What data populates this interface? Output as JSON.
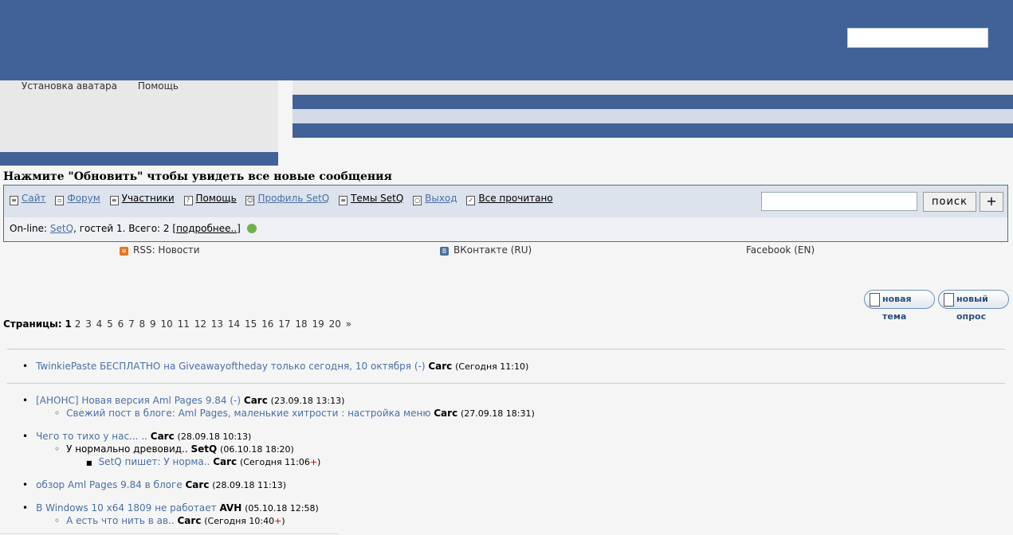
{
  "header": {
    "search_value": ""
  },
  "left_links": {
    "avatar": "Установка аватара",
    "help": "Помощь"
  },
  "refresh_notice": "Нажмите \"Обновить\" чтобы увидеть все новые сообщения",
  "nav": {
    "items": [
      {
        "label": "Сайт",
        "icon": "site-icon",
        "blue": true
      },
      {
        "label": "Форум",
        "icon": "forum-icon",
        "blue": true
      },
      {
        "label": "Участники",
        "icon": "members-icon",
        "blue": false
      },
      {
        "label": "Помощь",
        "icon": "help-icon",
        "blue": false
      },
      {
        "label": "Профиль SetQ",
        "icon": "profile-icon",
        "blue": true
      },
      {
        "label": "Темы SetQ",
        "icon": "topics-icon",
        "blue": false
      },
      {
        "label": "Выход",
        "icon": "logout-icon",
        "blue": true
      },
      {
        "label": "Все прочитано",
        "icon": "checkbox-icon",
        "blue": false
      }
    ],
    "search_button": "поиск",
    "plus_button": "+"
  },
  "online": {
    "prefix": "On-line:",
    "user": "SetQ",
    "rest": ", гостей 1. Всего: 2 [",
    "more": "подробнее..",
    "close": "]"
  },
  "social": {
    "rss": "RSS: Новости",
    "vk": "ВКонтакте (RU)",
    "fb": "Facebook (EN)"
  },
  "buttons": {
    "new_topic": "новая тема",
    "new_poll": "новый опрос"
  },
  "pagination": {
    "label": "Страницы:",
    "current": "1",
    "pages": [
      "2",
      "3",
      "4",
      "5",
      "6",
      "7",
      "8",
      "9",
      "10",
      "11",
      "12",
      "13",
      "14",
      "15",
      "16",
      "17",
      "18",
      "19",
      "20",
      "»"
    ]
  },
  "topics": {
    "t1": {
      "title": "TwinkiePaste БЕСПЛАТНО на Giveawayoftheday только сегодня, 10 октября (-)",
      "author": "Carc",
      "date": "(Сегодня 11:10)"
    },
    "t2": {
      "title": "[АНОНС] Новая версия Aml Pages 9.84 (-)",
      "author": "Carc",
      "date": "(23.09.18 13:13)"
    },
    "t2a": {
      "title": "Свежий пост в блоге: Aml Pages, маленькие хитрости : настройка меню",
      "author": "Carc",
      "date": "(27.09.18 18:31)"
    },
    "t3": {
      "title": "Чего то тихо у нас... ..",
      "author": "Carc",
      "date": "(28.09.18 10:13)"
    },
    "t3a": {
      "title": "У нормально древовид..",
      "author": "SetQ",
      "date": "(06.10.18 18:20)"
    },
    "t3b": {
      "title": "SetQ пишет: У норма..",
      "author": "Carc",
      "date": "(Сегодня 11:06",
      "plus": "+",
      "close": ")"
    },
    "t4": {
      "title": "обзор Aml Pages 9.84 в блоге",
      "author": "Carc",
      "date": "(28.09.18 11:13)"
    },
    "t5": {
      "title": "В Windows 10 x64 1809 не работает",
      "author": "AVH",
      "date": "(05.10.18 12:58)"
    },
    "t5a": {
      "title": "А есть что нить в ав..",
      "author": "Carc",
      "date": "(Сегодня 10:40",
      "plus": "+",
      "close": ")"
    }
  }
}
